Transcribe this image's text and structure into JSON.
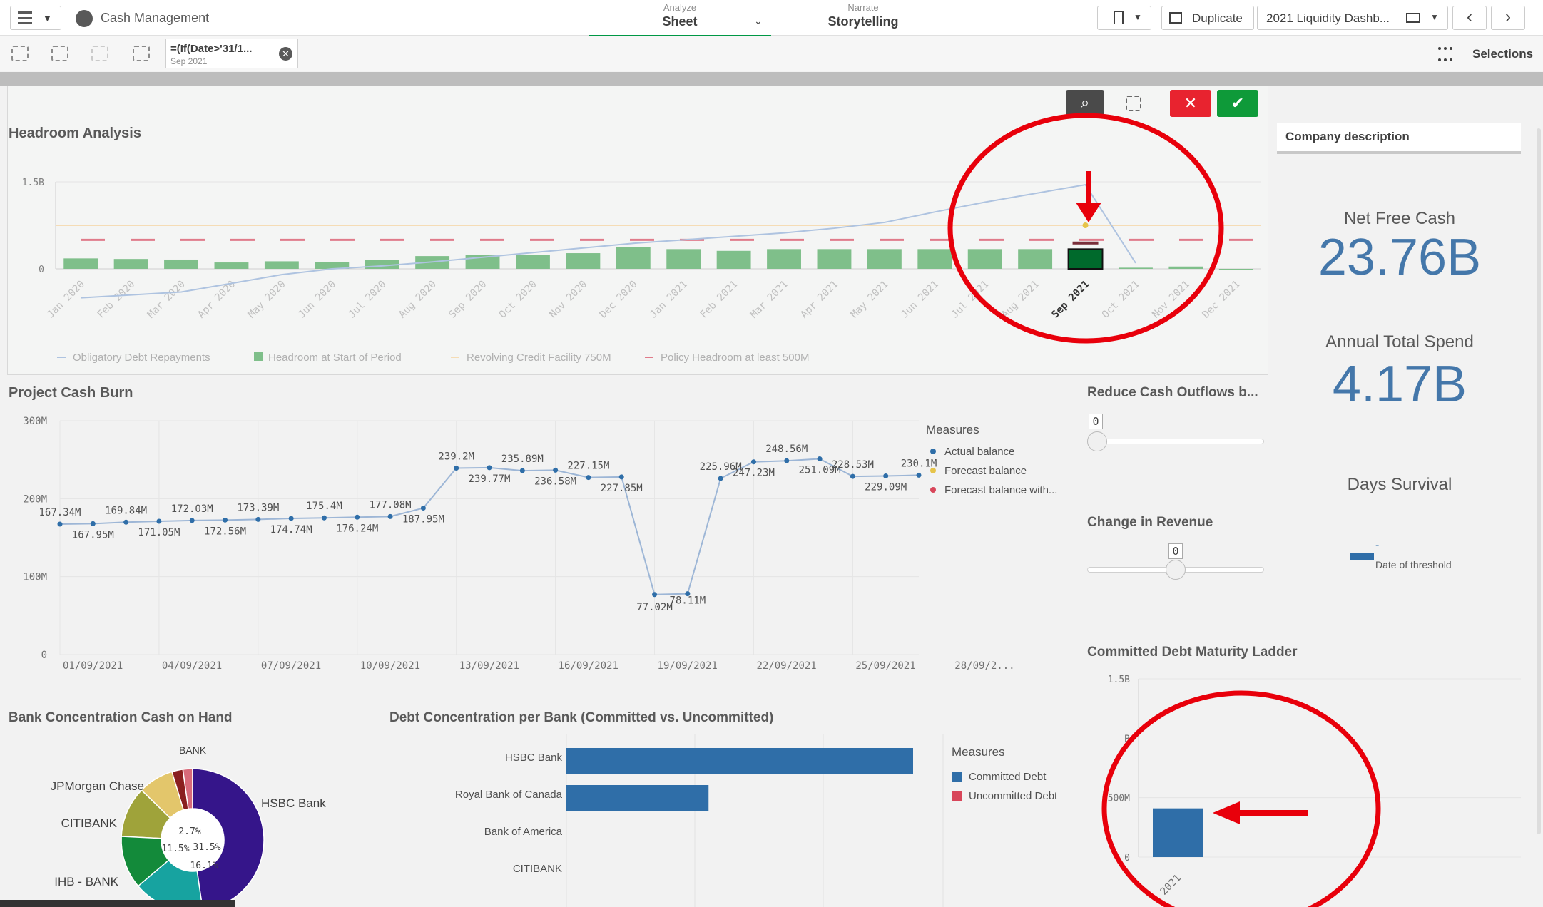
{
  "app": {
    "name": "Cash Management"
  },
  "nav": {
    "analyze_label": "Analyze",
    "analyze_value": "Sheet",
    "narrate_label": "Narrate",
    "narrate_value": "Storytelling"
  },
  "toolbar": {
    "duplicate_label": "Duplicate",
    "sheet_name": "2021 Liquidity Dashb...",
    "selections_label": "Selections"
  },
  "selection_chip": {
    "expression": "=(If(Date>'31/1...",
    "value": "Sep 2021"
  },
  "colors": {
    "accent_green": "#009845",
    "bar_green": "#7fbf8a",
    "selected_bar": "#006a2c",
    "line_blue": "#aec3e0",
    "kpi_blue": "#4477aa",
    "bar_blue": "#2f6ea8",
    "policy_pink": "#e07b8a",
    "annotation_red": "#e8000b"
  },
  "headroom": {
    "title": "Headroom Analysis",
    "legend": [
      "Headroom at Start of Period",
      "Obligatory Debt Repayments",
      "Revolving Credit Facility 750M",
      "Policy Headroom at least 500M"
    ]
  },
  "side": {
    "company_description": "Company description",
    "net_free_cash_label": "Net Free Cash",
    "net_free_cash_value": "23.76B",
    "annual_spend_label": "Annual Total Spend",
    "annual_spend_value": "4.17B",
    "days_survival_label": "Days Survival",
    "threshold_label": "Date of threshold",
    "threshold_dash": "-",
    "reduce_outflows_label": "Reduce Cash Outflows b...",
    "reduce_outflows_value": "0",
    "change_revenue_label": "Change in Revenue",
    "change_revenue_value": "0"
  },
  "cash_burn": {
    "title": "Project Cash Burn",
    "legend_title": "Measures",
    "legend": [
      "Actual balance",
      "Forecast balance",
      "Forecast balance with..."
    ]
  },
  "bank_concentration": {
    "title": "Bank Concentration Cash on Hand"
  },
  "debt_concentration": {
    "title": "Debt Concentration per Bank (Committed vs. Uncommitted)",
    "legend_title": "Measures",
    "legend": [
      "Committed Debt",
      "Uncommitted Debt"
    ]
  },
  "maturity_ladder": {
    "title": "Committed Debt Maturity Ladder"
  },
  "chart_data": [
    {
      "type": "bar",
      "id": "headroom",
      "categories": [
        "Jan 2020",
        "Feb 2020",
        "Mar 2020",
        "Apr 2020",
        "May 2020",
        "Jun 2020",
        "Jul 2020",
        "Aug 2020",
        "Sep 2020",
        "Oct 2020",
        "Nov 2020",
        "Dec 2020",
        "Jan 2021",
        "Feb 2021",
        "Mar 2021",
        "Apr 2021",
        "May 2021",
        "Jun 2021",
        "Jul 2021",
        "Aug 2021",
        "Sep 2021",
        "Oct 2021",
        "Nov 2021",
        "Dec 2021"
      ],
      "selected": "Sep 2021",
      "y_ticks": [
        "0",
        "1.5B"
      ],
      "ylim": [
        0,
        1.5
      ],
      "series": [
        {
          "name": "Obligatory Debt Repayments",
          "values": [
            0.18,
            0.17,
            0.16,
            0.11,
            0.13,
            0.12,
            0.15,
            0.22,
            0.24,
            0.24,
            0.27,
            0.37,
            0.34,
            0.31,
            0.34,
            0.34,
            0.34,
            0.34,
            0.34,
            0.34,
            0.34,
            0.02,
            0.04,
            0
          ]
        },
        {
          "name": "Headroom at Start of Period",
          "values": [
            -0.5,
            -0.45,
            -0.4,
            -0.25,
            -0.1,
            0.0,
            0.05,
            0.12,
            0.2,
            0.28,
            0.36,
            0.44,
            0.5,
            0.56,
            0.62,
            0.7,
            0.8,
            0.98,
            1.15,
            1.3,
            1.45,
            0.1,
            null,
            null
          ]
        },
        {
          "name": "Revolving Credit Facility 750M",
          "values": [
            0.75
          ]
        },
        {
          "name": "Policy Headroom at least 500M",
          "values": [
            0.5
          ]
        }
      ]
    },
    {
      "type": "line",
      "id": "cash_burn",
      "x_ticks": [
        "01/09/2021",
        "04/09/2021",
        "07/09/2021",
        "10/09/2021",
        "13/09/2021",
        "16/09/2021",
        "19/09/2021",
        "22/09/2021",
        "25/09/2021",
        "28/09/2..."
      ],
      "y_ticks": [
        "0",
        "100M",
        "200M",
        "300M"
      ],
      "ylim": [
        0,
        300
      ],
      "series": [
        {
          "name": "Actual balance",
          "values": [
            167.34,
            167.95,
            169.84,
            171.05,
            172.03,
            172.56,
            173.39,
            174.74,
            175.4,
            176.24,
            177.08,
            187.95,
            239.2,
            239.77,
            235.89,
            236.58,
            227.15,
            227.85,
            77.02,
            78.11,
            225.96,
            247.23,
            248.56,
            251.09,
            228.53,
            229.09,
            230.1
          ]
        }
      ],
      "labels": [
        "167.34M",
        "167.95M",
        "169.84M",
        "171.05M",
        "172.03M",
        "172.56M",
        "173.39M",
        "174.74M",
        "175.4M",
        "176.24M",
        "177.08M",
        "187.95M",
        "239.2M",
        "239.77M",
        "235.89M",
        "236.58M",
        "227.15M",
        "227.85M",
        "77.02M",
        "78.11M",
        "225.96M",
        "247.23M",
        "248.56M",
        "251.09M",
        "228.53M",
        "229.09M",
        "230.1M"
      ]
    },
    {
      "type": "pie",
      "id": "bank_concentration",
      "categories": [
        "BANK",
        "JPMorgan Chase",
        "CITIBANK",
        "IHB - BANK",
        "HSBC Bank"
      ],
      "labels": [
        "2.7%",
        "11.5%",
        "31.5%",
        "16.1%"
      ],
      "values": [
        2.7,
        11.5,
        31.5,
        16.1
      ]
    },
    {
      "type": "bar",
      "id": "debt_concentration",
      "categories": [
        "HSBC Bank",
        "Royal Bank of Canada",
        "Bank of America",
        "CITIBANK"
      ],
      "series": [
        {
          "name": "Committed Debt",
          "values": [
            1.0,
            0.41,
            0,
            0
          ]
        },
        {
          "name": "Uncommitted Debt",
          "values": [
            0,
            0,
            0,
            0
          ]
        }
      ]
    },
    {
      "type": "bar",
      "id": "maturity_ladder",
      "categories": [
        "2021"
      ],
      "y_ticks": [
        "0",
        "500M",
        "1.5B"
      ],
      "ylim": [
        0,
        1.5
      ],
      "values": [
        0.41
      ]
    }
  ]
}
